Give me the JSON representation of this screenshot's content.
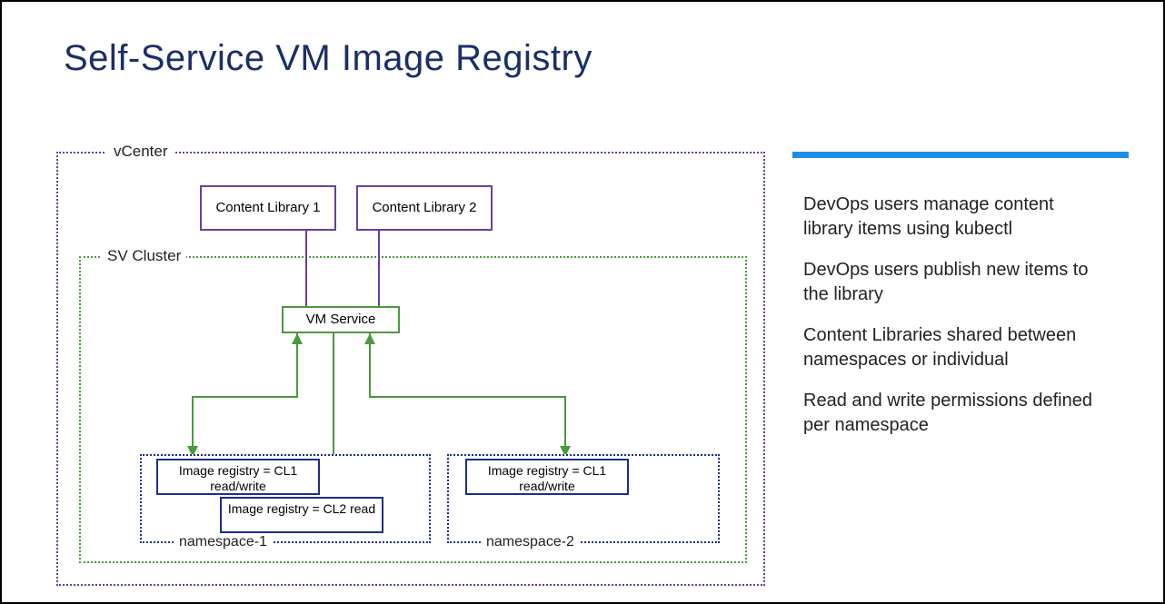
{
  "title": "Self-Service VM Image Registry",
  "diagram": {
    "vcenter_label": "vCenter",
    "svcluster_label": "SV Cluster",
    "content_library_1": "Content Library 1",
    "content_library_2": "Content Library 2",
    "vm_service": "VM Service",
    "namespace_1": {
      "label": "namespace-1",
      "reg1": "Image registry = CL1 read/write",
      "reg2": "Image registry = CL2 read"
    },
    "namespace_2": {
      "label": "namespace-2",
      "reg1": "Image registry = CL1 read/write"
    }
  },
  "bullets": [
    "DevOps users manage content library items using kubectl",
    "DevOps users publish new items to the library",
    "Content Libraries shared between namespaces or individual",
    "Read and write permissions defined per namespace"
  ]
}
